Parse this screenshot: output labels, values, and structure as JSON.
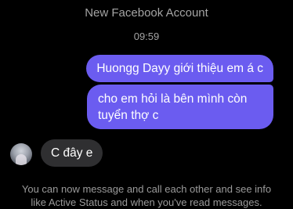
{
  "chat": {
    "account_label": "New Facebook Account",
    "timestamp": "09:59",
    "messages": [
      {
        "direction": "outgoing",
        "text": "Huongg Dayy giới thiệu em á c"
      },
      {
        "direction": "outgoing",
        "text": "cho em hỏi là bên mình còn tuyển thợ c"
      },
      {
        "direction": "incoming",
        "text": "C đây e"
      }
    ],
    "info_line_1": "You can now message and call each other and see info",
    "info_line_2": "like Active Status and when you've read messages."
  },
  "colors": {
    "background": "#000000",
    "outgoing_bubble": "#6b5cf0",
    "incoming_bubble": "#2f2f31",
    "meta_text": "#a4a4a4"
  }
}
